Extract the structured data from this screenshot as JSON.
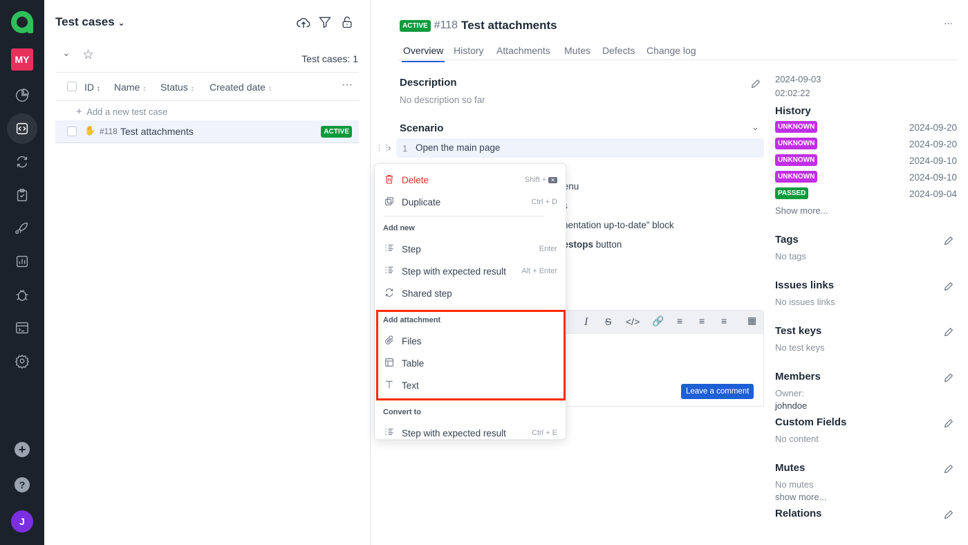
{
  "sidebar": {
    "logo": "allure-logo",
    "project_badge": "MY",
    "items": [
      "dashboard-icon",
      "test-cases-icon",
      "launches-icon",
      "test-plans-icon",
      "jobs-icon",
      "analytics-icon",
      "defects-icon",
      "environments-icon",
      "settings-icon"
    ],
    "bottom": [
      "add-icon",
      "help-icon"
    ],
    "avatar": "J",
    "colors": {
      "bg": "#1c222b",
      "project": "#e8305d",
      "avatar": "#7c2fe0"
    }
  },
  "list": {
    "title": "Test cases",
    "count": "Test cases: 1",
    "columns": [
      "ID",
      "Name",
      "Status",
      "Created date"
    ],
    "add_label": "Add a new test case",
    "rows": [
      {
        "id": "#118",
        "name": "Test attachments",
        "status": "ACTIVE"
      }
    ]
  },
  "detail": {
    "status": "ACTIVE",
    "id": "#118",
    "title": "Test attachments",
    "tabs": [
      "Overview",
      "History",
      "Attachments",
      "Mutes",
      "Defects",
      "Change log"
    ],
    "active_tab": "Overview",
    "description_title": "Description",
    "description": "No description so far",
    "scenario_title": "Scenario",
    "steps": [
      {
        "num": "1",
        "text": "Open the main page"
      }
    ],
    "hidden_fragments": [
      "bmenu",
      "s",
      "cumentation up-to-date” block"
    ],
    "frag_bold": "Testops",
    "frag_pre": "e ",
    "frag_post": " button",
    "comment_button": "Leave a comment"
  },
  "menu": {
    "delete": "Delete",
    "delete_sc": "Shift +",
    "duplicate": "Duplicate",
    "duplicate_sc": "Ctrl + D",
    "add_new": "Add new",
    "step": "Step",
    "step_sc": "Enter",
    "step_exp": "Step with expected result",
    "step_exp_sc": "Alt + Enter",
    "shared": "Shared step",
    "add_attachment": "Add attachment",
    "files": "Files",
    "table": "Table",
    "text": "Text",
    "convert_to": "Convert to",
    "convert_step": "Step with expected result",
    "convert_sc": "Ctrl + E"
  },
  "right": {
    "created_date": "2024-09-03",
    "created_time": "02:02:22",
    "history_title": "History",
    "history": [
      {
        "status": "UNKNOWN",
        "date": "2024-09-20"
      },
      {
        "status": "UNKNOWN",
        "date": "2024-09-20"
      },
      {
        "status": "UNKNOWN",
        "date": "2024-09-10"
      },
      {
        "status": "UNKNOWN",
        "date": "2024-09-10"
      },
      {
        "status": "PASSED",
        "date": "2024-09-04"
      }
    ],
    "show_more": "Show more...",
    "sections": [
      {
        "title": "Tags",
        "value": "No tags"
      },
      {
        "title": "Issues links",
        "value": "No issues links"
      },
      {
        "title": "Test keys",
        "value": "No test keys"
      },
      {
        "title": "Members",
        "value": "Owner:",
        "value2": "johndoe"
      },
      {
        "title": "Custom Fields",
        "value": "No content"
      },
      {
        "title": "Mutes",
        "value": "No mutes",
        "value2": "show more..."
      },
      {
        "title": "Relations"
      }
    ]
  },
  "colors": {
    "active": "#0e9a3d",
    "unknown": "#c02fe6",
    "accent": "#1d5fd6",
    "highlight": "#ff2a00"
  }
}
